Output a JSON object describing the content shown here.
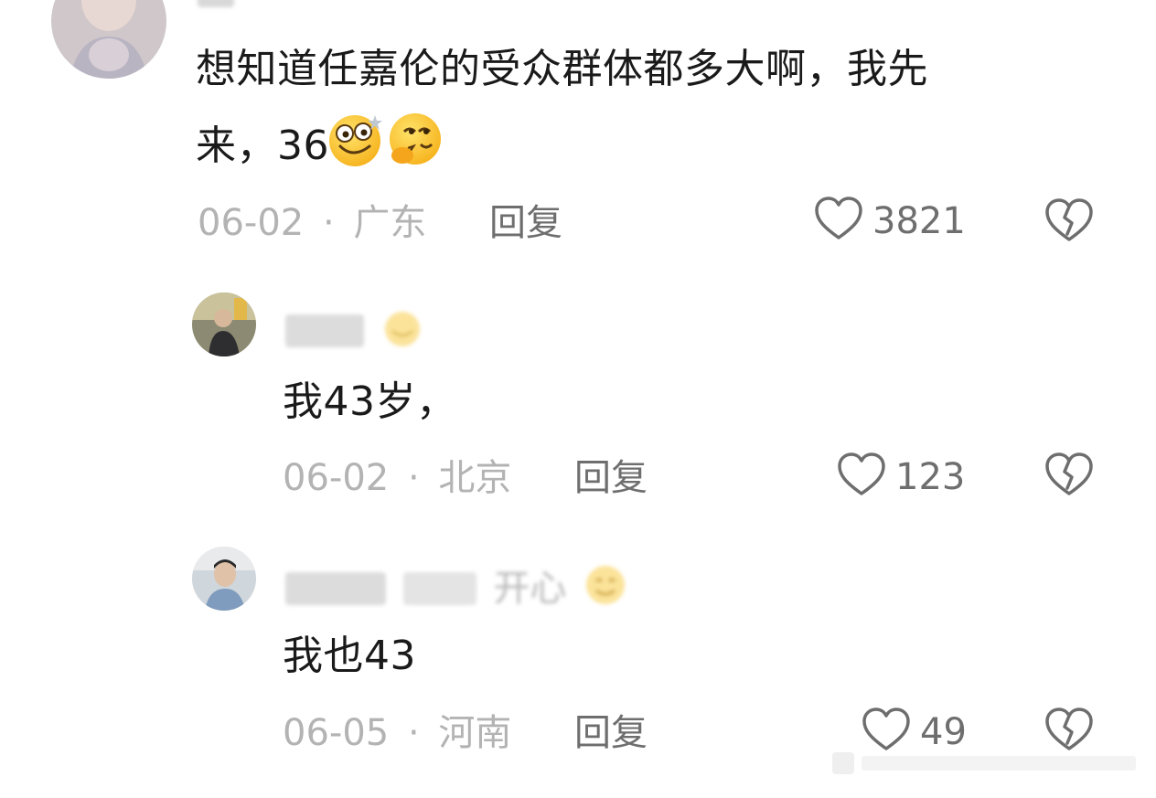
{
  "comments": [
    {
      "text_line1": "想知道任嘉伦的受众群体都多大啊，我先",
      "text_line2": "来，36",
      "emojis": [
        "dizzy-face-emoji",
        "shy-blushing-emoji"
      ],
      "date": "06-02",
      "separator": "·",
      "location": "广东",
      "reply_label": "回复",
      "likes": "3821"
    },
    {
      "text": "我43岁，",
      "date": "06-02",
      "separator": "·",
      "location": "北京",
      "reply_label": "回复",
      "likes": "123"
    },
    {
      "username_visible": "开心",
      "text": "我也43",
      "date": "06-05",
      "separator": "·",
      "location": "河南",
      "reply_label": "回复",
      "likes": "49"
    }
  ],
  "colors": {
    "text": "#1a1a1a",
    "meta": "#b3b3b3",
    "action": "#6e6e6e"
  }
}
